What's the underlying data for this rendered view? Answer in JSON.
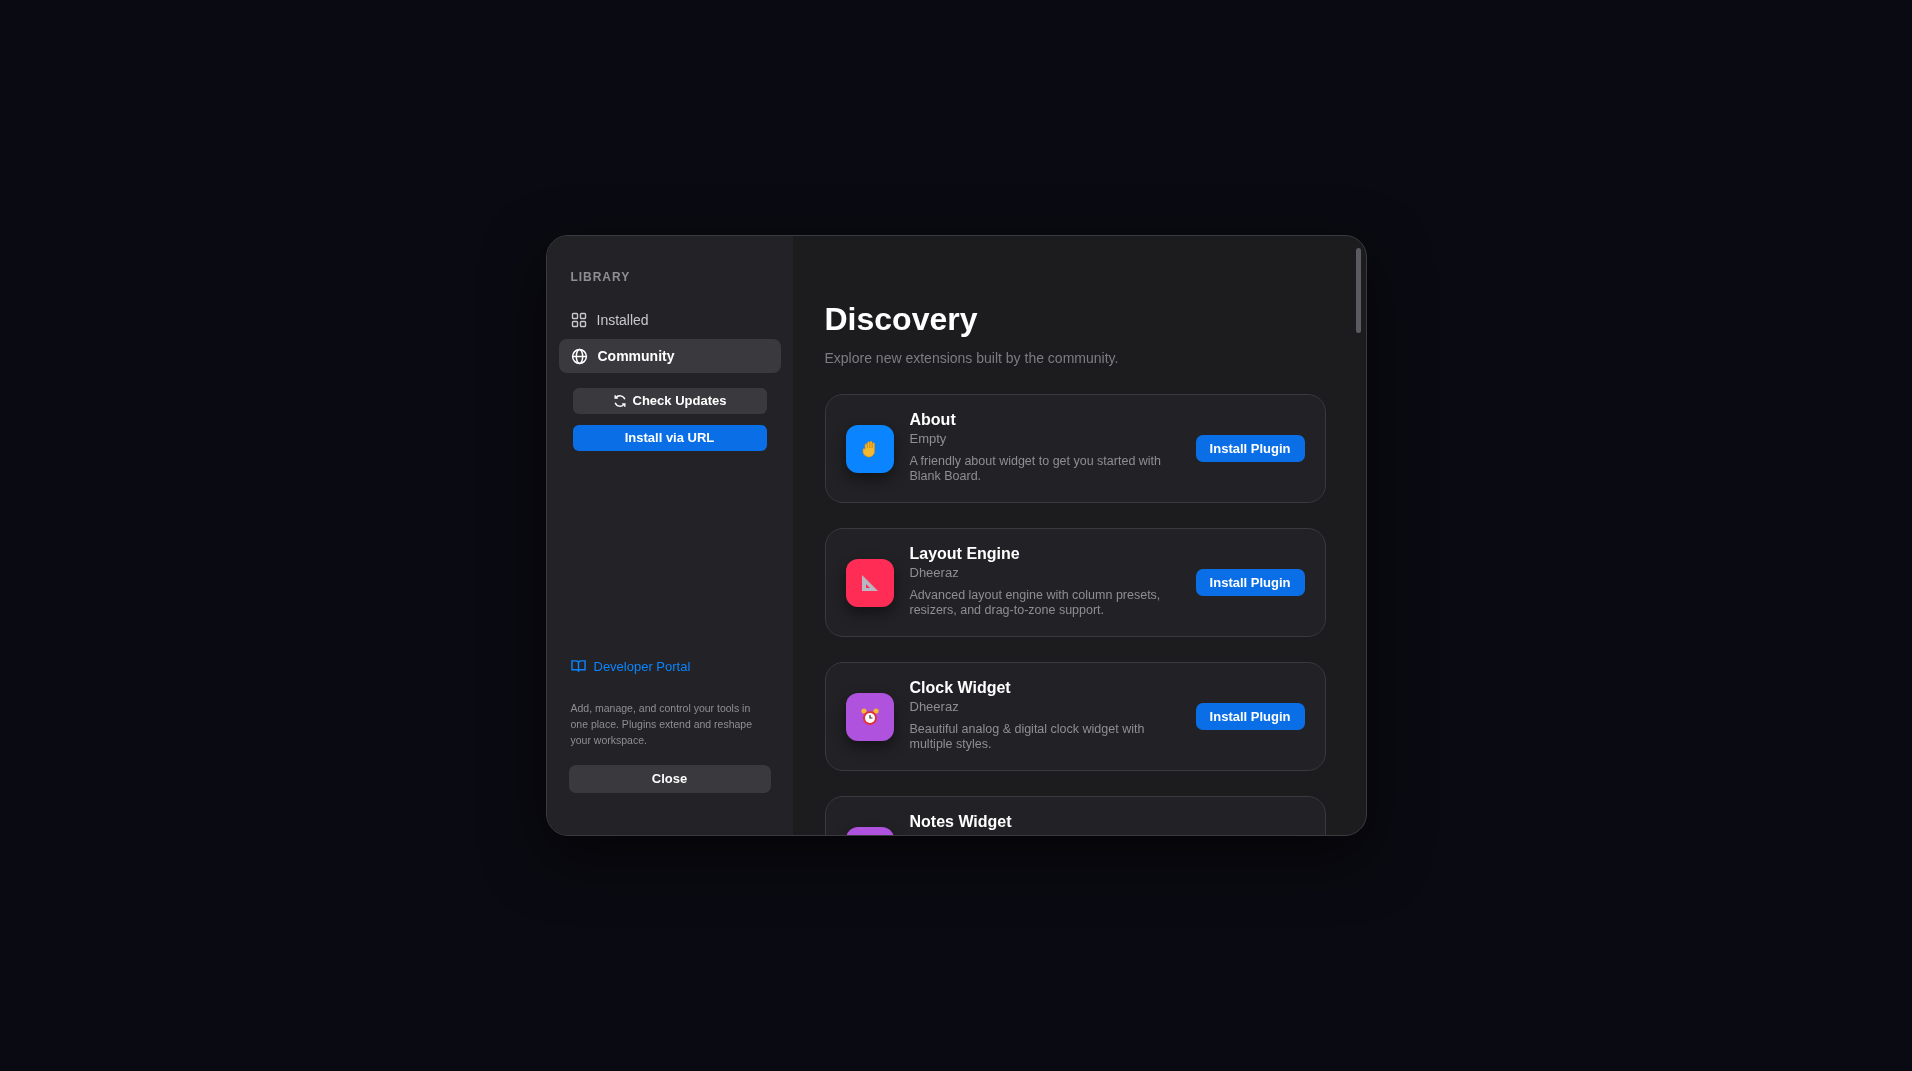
{
  "sidebar": {
    "heading": "LIBRARY",
    "items": [
      {
        "label": "Installed",
        "kind": "grid",
        "selected": false
      },
      {
        "label": "Community",
        "kind": "globe",
        "selected": true
      }
    ],
    "check_updates_button": "Check Updates",
    "install_url_button": "Install via URL",
    "developer_link": "Developer Portal",
    "description": "Add, manage, and control your tools in one place. Plugins extend and reshape your workspace.",
    "close_button": "Close"
  },
  "main": {
    "title": "Discovery",
    "subtitle": "Explore new extensions built by the community.",
    "plugins": [
      {
        "name": "About",
        "author": "Empty",
        "description": "A friendly about widget to get you started with Blank Board.",
        "kind": "hand",
        "color": "#0a84ff",
        "button": "Install Plugin"
      },
      {
        "name": "Layout Engine",
        "author": "Dheeraz",
        "description": "Advanced layout engine with column presets, resizers, and drag-to-zone support.",
        "kind": "ruler",
        "color": "#ff2d55",
        "button": "Install Plugin"
      },
      {
        "name": "Clock Widget",
        "author": "Dheeraz",
        "description": "Beautiful analog & digital clock widget with multiple styles.",
        "kind": "clock",
        "color": "#af52de",
        "button": "Install Plugin"
      },
      {
        "name": "Notes Widget",
        "kind": "tile",
        "color": "#af52de"
      }
    ]
  }
}
